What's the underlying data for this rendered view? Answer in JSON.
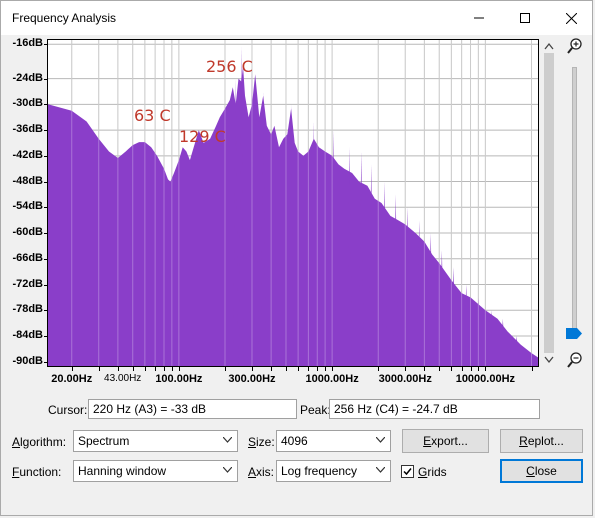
{
  "window": {
    "title": "Frequency Analysis"
  },
  "icons": {
    "minimize": "minimize-icon",
    "maximize": "maximize-icon",
    "close": "close-icon",
    "zoom_in": "zoom-in-icon",
    "zoom_out": "zoom-out-icon",
    "check": "check-icon"
  },
  "annotations": [
    "256 C",
    "63 C",
    "129 C"
  ],
  "chart_data": {
    "type": "area",
    "title": "",
    "xlabel": "",
    "ylabel": "",
    "x_scale": "log",
    "xlim": [
      14,
      22050
    ],
    "ylim": [
      -91,
      -15
    ],
    "y_ticks": [
      "-16dB",
      "-24dB",
      "-30dB",
      "-36dB",
      "-42dB",
      "-48dB",
      "-54dB",
      "-60dB",
      "-66dB",
      "-72dB",
      "-78dB",
      "-84dB",
      "-90dB"
    ],
    "x_ticks": [
      "20.00Hz",
      "43.00Hz",
      "100.00Hz",
      "300.00Hz",
      "1000.00Hz",
      "3000.00Hz",
      "10000.00Hz"
    ],
    "grid": true,
    "color": "#8a3ec9",
    "points": [
      [
        14,
        -30
      ],
      [
        20,
        -31.5
      ],
      [
        25,
        -34
      ],
      [
        30,
        -38
      ],
      [
        35,
        -41
      ],
      [
        40,
        -42.5
      ],
      [
        45,
        -41
      ],
      [
        50,
        -39.5
      ],
      [
        55,
        -38.8
      ],
      [
        60,
        -38.8
      ],
      [
        66,
        -40
      ],
      [
        72,
        -42
      ],
      [
        80,
        -45
      ],
      [
        85,
        -47.5
      ],
      [
        88,
        -48
      ],
      [
        93,
        -46
      ],
      [
        100,
        -43
      ],
      [
        106,
        -40
      ],
      [
        112,
        -41
      ],
      [
        118,
        -43
      ],
      [
        125,
        -40
      ],
      [
        135,
        -36
      ],
      [
        145,
        -39
      ],
      [
        160,
        -38
      ],
      [
        175,
        -35
      ],
      [
        185,
        -33
      ],
      [
        200,
        -31
      ],
      [
        215,
        -29
      ],
      [
        225,
        -26
      ],
      [
        235,
        -30
      ],
      [
        245,
        -24
      ],
      [
        256,
        -24.7
      ],
      [
        262,
        -21
      ],
      [
        270,
        -28
      ],
      [
        285,
        -33
      ],
      [
        300,
        -30
      ],
      [
        315,
        -23
      ],
      [
        335,
        -33
      ],
      [
        355,
        -28
      ],
      [
        375,
        -35
      ],
      [
        400,
        -37
      ],
      [
        420,
        -35
      ],
      [
        450,
        -40
      ],
      [
        480,
        -38
      ],
      [
        510,
        -37
      ],
      [
        540,
        -31
      ],
      [
        570,
        -39
      ],
      [
        600,
        -41
      ],
      [
        650,
        -42
      ],
      [
        700,
        -41
      ],
      [
        760,
        -38
      ],
      [
        820,
        -40
      ],
      [
        900,
        -41
      ],
      [
        1000,
        -42
      ],
      [
        1100,
        -44
      ],
      [
        1200,
        -45
      ],
      [
        1350,
        -46
      ],
      [
        1500,
        -48
      ],
      [
        1700,
        -49
      ],
      [
        1900,
        -52
      ],
      [
        2100,
        -53
      ],
      [
        2400,
        -56
      ],
      [
        2700,
        -57
      ],
      [
        3000,
        -58
      ],
      [
        3500,
        -60
      ],
      [
        4000,
        -62
      ],
      [
        4500,
        -65
      ],
      [
        5000,
        -67
      ],
      [
        6000,
        -71
      ],
      [
        7000,
        -74
      ],
      [
        8000,
        -75
      ],
      [
        10000,
        -78
      ],
      [
        12000,
        -80
      ],
      [
        14000,
        -83
      ],
      [
        17000,
        -86
      ],
      [
        20000,
        -88
      ],
      [
        22050,
        -89
      ]
    ],
    "peaks": [
      [
        256,
        -16.5
      ],
      [
        235,
        -24
      ],
      [
        300,
        -22
      ],
      [
        320,
        -26
      ],
      [
        355,
        -27
      ],
      [
        540,
        -30
      ],
      [
        760,
        -34
      ],
      [
        1020,
        -36
      ],
      [
        1300,
        -40
      ],
      [
        1550,
        -41
      ],
      [
        1800,
        -44
      ],
      [
        2200,
        -48
      ],
      [
        2600,
        -51
      ],
      [
        3100,
        -54
      ],
      [
        3700,
        -57
      ],
      [
        4400,
        -60
      ],
      [
        5200,
        -64
      ],
      [
        6200,
        -68
      ],
      [
        7500,
        -72
      ],
      [
        9000,
        -75
      ],
      [
        11000,
        -78
      ],
      [
        13000,
        -80
      ],
      [
        16000,
        -84
      ]
    ]
  },
  "cursor": {
    "label": "Cursor:",
    "value": "220 Hz (A3) = -33 dB"
  },
  "peak": {
    "label": "Peak:",
    "value": "256 Hz (C4) = -24.7 dB"
  },
  "controls": {
    "algorithm_label": "Algorithm:",
    "algorithm_value": "Spectrum",
    "size_label": "Size:",
    "size_value": "4096",
    "function_label": "Function:",
    "function_value": "Hanning window",
    "axis_label": "Axis:",
    "axis_value": "Log frequency",
    "grids_label": "Grids",
    "grids_checked": true,
    "export_label": "Export...",
    "replot_label": "Replot...",
    "close_label": "Close"
  }
}
